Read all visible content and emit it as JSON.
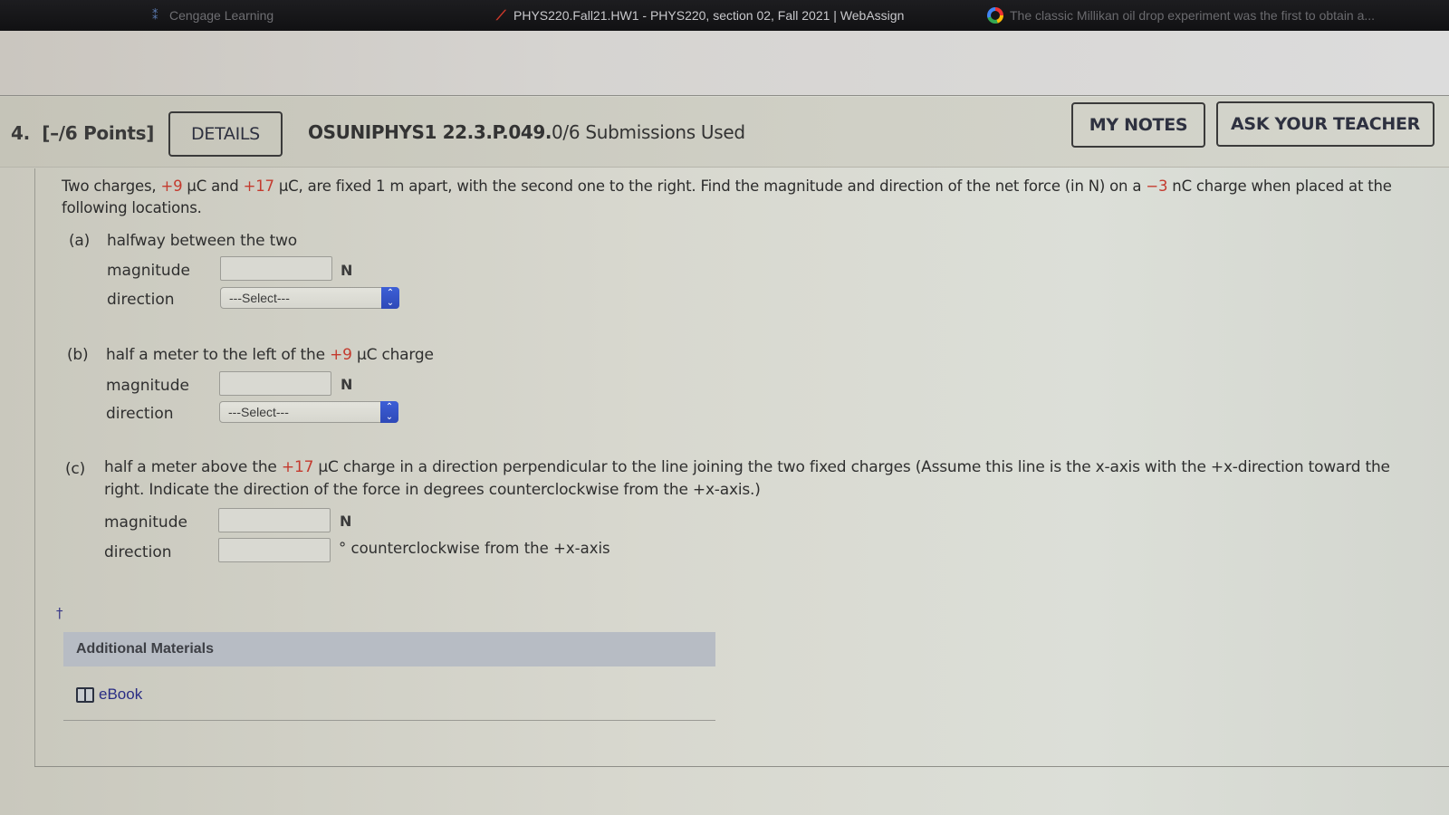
{
  "browser": {
    "tabs": [
      {
        "label": "Cengage Learning",
        "icon": "cengage-icon",
        "active": false
      },
      {
        "label": "PHYS220.Fall21.HW1 - PHYS220, section 02, Fall 2021 | WebAssign",
        "icon": "webassign-icon",
        "active": true
      },
      {
        "label": "The classic Millikan oil drop experiment was the first to obtain a...",
        "icon": "google-icon",
        "active": false
      }
    ]
  },
  "question": {
    "number": "4.",
    "points": "[–/6 Points]",
    "details_label": "DETAILS",
    "code": "OSUNIPHYS1 22.3.P.049.",
    "submissions": "0/6 Submissions Used",
    "my_notes_label": "MY NOTES",
    "ask_teacher_label": "ASK YOUR TEACHER",
    "prompt": {
      "t1": "Two charges, ",
      "q1": "+9",
      "t2": " μC and ",
      "q2": "+17",
      "t3": " μC, are fixed 1 m apart, with the second one to the right. Find the magnitude and direction of the net force (in N) on a ",
      "q3": "−3",
      "t4": " nC charge when placed at the following locations."
    },
    "parts": [
      {
        "label": "(a)",
        "text": "halfway between the two",
        "magnitude_label": "magnitude",
        "magnitude_value": "",
        "unit": "N",
        "direction_label": "direction",
        "direction_value": "---Select---"
      },
      {
        "label": "(b)",
        "text_before": "half a meter to the left of the ",
        "charge": "+9",
        "text_after": " μC charge",
        "magnitude_label": "magnitude",
        "magnitude_value": "",
        "unit": "N",
        "direction_label": "direction",
        "direction_value": "---Select---"
      },
      {
        "label": "(c)",
        "text_before": "half a meter above the ",
        "charge": "+17",
        "text_after": " μC charge in a direction perpendicular to the line joining the two fixed charges (Assume this line is the x-axis with the +x-direction toward the right. Indicate the direction of the force in degrees counterclockwise from the +x-axis.)",
        "magnitude_label": "magnitude",
        "magnitude_value": "",
        "unit": "N",
        "direction_label": "direction",
        "direction_value": "",
        "direction_unit": "° counterclockwise from the +x-axis"
      }
    ]
  },
  "additional_materials": {
    "title": "Additional Materials",
    "links": [
      {
        "label": "eBook",
        "icon": "book-icon"
      }
    ]
  },
  "colors": {
    "charge_red": "#c43a2e",
    "select_accent": "#3d5fd6",
    "link_blue": "#2a2d84"
  }
}
